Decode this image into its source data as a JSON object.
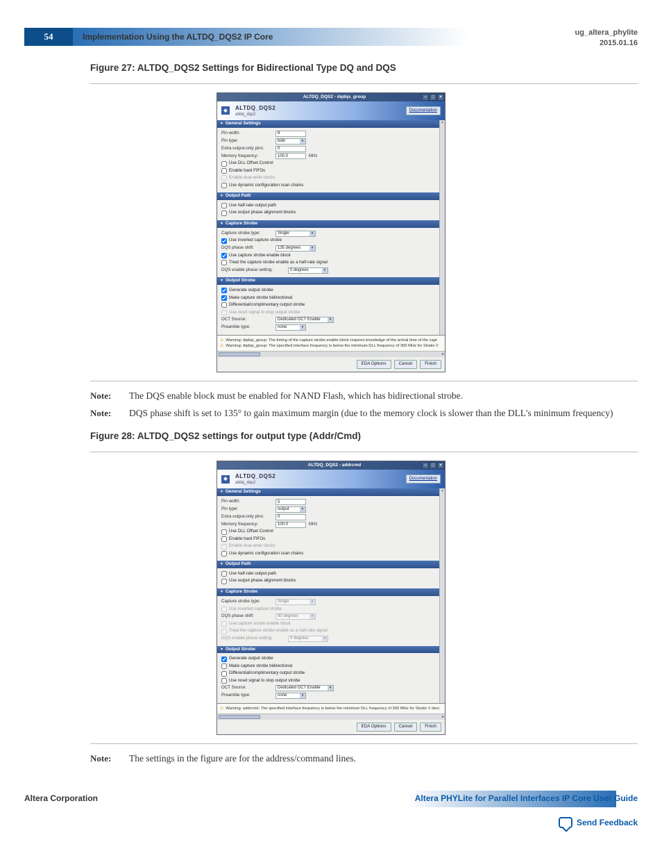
{
  "header": {
    "page_number": "54",
    "section_title": "Implementation Using the ALTDQ_DQS2 IP Core",
    "doc_code": "ug_altera_phylite",
    "doc_date": "2015.01.16"
  },
  "figure27": {
    "caption": "Figure 27: ALTDQ_DQS2 Settings for Bidirectional Type DQ and DQS",
    "dialog_title": "ALTDQ_DQS2 - dqdqs_group",
    "ip_name": "ALTDQ_DQS2",
    "ip_sub": "altdq_dqs2",
    "doc_btn": "Documentation",
    "sections": {
      "general": "General Settings",
      "output_path": "Output Path",
      "capture": "Capture Strobe",
      "output_strobe": "Output Strobe"
    },
    "general": {
      "pin_width_label": "Pin width:",
      "pin_width_value": "8",
      "pin_type_label": "Pin type:",
      "pin_type_value": "bidir",
      "extra_pins_label": "Extra output-only pins:",
      "extra_pins_value": "0",
      "mem_freq_label": "Memory frequency:",
      "mem_freq_value": "100.0",
      "mem_freq_unit": "MHz",
      "use_dll": "Use DLL Offset Control",
      "enable_fifos": "Enable hard FIFOs",
      "enable_dual_write": "Enable dual-write clocks",
      "use_dynamic": "Use dynamic configuration scan chains"
    },
    "output_path": {
      "half_rate": "Use half-rate output path",
      "phase_align": "Use output phase alignment blocks"
    },
    "capture": {
      "type_label": "Capture strobe type:",
      "type_value": "Single",
      "use_inverted": "Use inverted capture strobe",
      "dqs_phase_label": "DQS phase shift:",
      "dqs_phase_value": "135 degrees",
      "use_enable_block": "Use capture strobe enable block",
      "treat_half_rate": "Treat the capture strobe enable as a half-rate signal",
      "dqs_enable_phase_label": "DQS enable phase setting:",
      "dqs_enable_phase_value": "0 degrees"
    },
    "output_strobe": {
      "generate": "Generate output strobe",
      "bidirectional": "Make capture strobe bidirectional",
      "differential": "Differential/complimentary output strobe",
      "use_reset": "Use reset signal to stop output strobe",
      "oct_source_label": "OCT Source:",
      "oct_source_value": "Dedicated OCT Enable",
      "preamble_label": "Preamble type:",
      "preamble_value": "none"
    },
    "warnings": [
      "Warning: dqdqs_group: The timing of the capture strobe enable block requires knowledge of the arrival time of the capt",
      "Warning: dqdqs_group: The specified interface frequency is below the minimum DLL frequency of 300 MHz for Stratix V"
    ],
    "buttons": {
      "eda": "EDA Options",
      "cancel": "Cancel",
      "finish": "Finish"
    }
  },
  "notes27": [
    "The DQS enable block must be enabled for NAND Flash, which has bidirectional strobe.",
    "DQS phase shift is set to 135° to gain maximum margin (due to the memory clock is slower than the DLL's minimum frequency)"
  ],
  "figure28": {
    "caption": "Figure 28: ALTDQ_DQS2 settings for output type (Addr/Cmd)",
    "dialog_title": "ALTDQ_DQS2 - addrcmd",
    "ip_name": "ALTDQ_DQS2",
    "ip_sub": "altdq_dqs2",
    "doc_btn": "Documentation",
    "general": {
      "pin_width_value": "5",
      "pin_type_value": "output",
      "extra_pins_value": "0",
      "mem_freq_value": "100.0",
      "mem_freq_unit": "MHz"
    },
    "capture": {
      "type_value": "Single",
      "dqs_phase_value": "90 degrees",
      "dqs_enable_phase_value": "0 degrees"
    },
    "output_strobe": {
      "oct_source_value": "Dedicated OCT Enable",
      "preamble_value": "none"
    },
    "warning": "Warning: addrcmd: The specified interface frequency is below the minimum DLL frequency of 300 MHz for Stratix V devi",
    "buttons": {
      "eda": "EDA Options",
      "cancel": "Cancel",
      "finish": "Finish"
    }
  },
  "note28": "The settings in the figure are for the address/command lines.",
  "footer": {
    "corp": "Altera Corporation",
    "guide": "Altera PHYLite for Parallel Interfaces IP Core User Guide",
    "feedback": "Send Feedback"
  },
  "labels": {
    "note": "Note:"
  }
}
